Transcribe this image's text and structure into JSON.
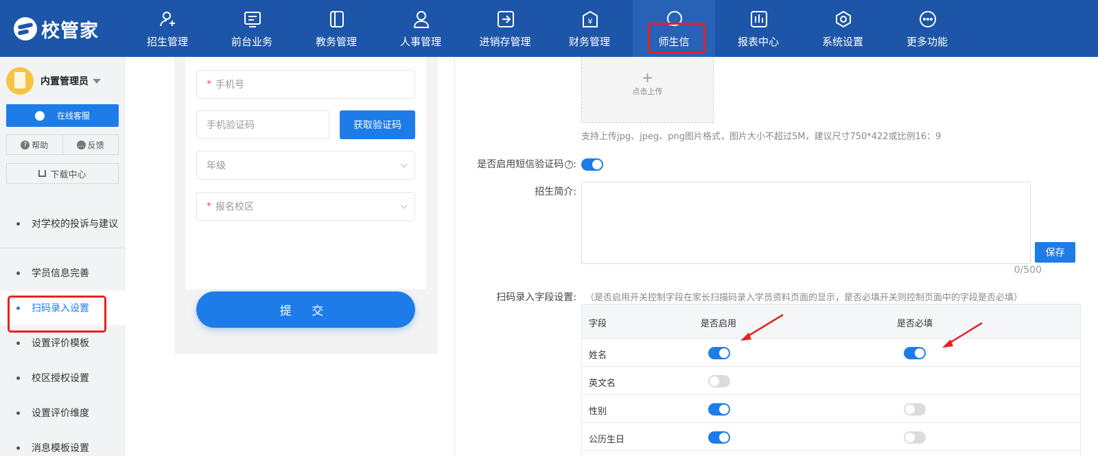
{
  "brand": {
    "name": "校管家"
  },
  "nav": {
    "items": [
      {
        "label": "招生管理",
        "icon": "user-add-icon"
      },
      {
        "label": "前台业务",
        "icon": "monitor-icon"
      },
      {
        "label": "教务管理",
        "icon": "book-icon"
      },
      {
        "label": "人事管理",
        "icon": "person-icon"
      },
      {
        "label": "进销存管理",
        "icon": "inventory-icon"
      },
      {
        "label": "财务管理",
        "icon": "finance-icon"
      },
      {
        "label": "师生信",
        "icon": "chat-icon",
        "active": true
      },
      {
        "label": "报表中心",
        "icon": "chart-icon"
      },
      {
        "label": "系统设置",
        "icon": "settings-icon"
      },
      {
        "label": "更多功能",
        "icon": "more-icon"
      }
    ]
  },
  "sidebar": {
    "user_name": "内置管理员",
    "service_label": "在线客服",
    "help_label": "帮助",
    "feedback_label": "反馈",
    "download_label": "下载中心",
    "items": [
      {
        "label": "对学校的投诉与建议"
      },
      {
        "label": "学员信息完善"
      },
      {
        "label": "扫码录入设置",
        "active": true
      },
      {
        "label": "设置评价模板"
      },
      {
        "label": "校区授权设置"
      },
      {
        "label": "设置评价维度"
      },
      {
        "label": "消息模板设置"
      }
    ]
  },
  "preview_form": {
    "phone_placeholder": "手机号",
    "code_placeholder": "手机验证码",
    "get_code_label": "获取验证码",
    "grade_placeholder": "年级",
    "campus_placeholder": "报名校区",
    "required_mark": "*",
    "submit_label": "提 交"
  },
  "settings": {
    "upload_plus": "+",
    "upload_label": "点击上传",
    "upload_hint": "支持上传jpg、jpeg、png图片格式，图片大小不超过5M，建议尺寸750*422或比例16：9",
    "sms_label": "是否启用短信验证码",
    "sms_help": "?",
    "sms_colon": ":",
    "sms_enabled": true,
    "intro_label": "招生简介:",
    "intro_value": "",
    "save_label": "保存",
    "counter": "0/500",
    "scan_label": "扫码录入字段设置:",
    "scan_desc": "（是否启用开关控制字段在家长扫描码录入学员资料页面的显示，是否必填开关则控制页面中的字段是否必填）",
    "table": {
      "headers": [
        "字段",
        "是否启用",
        "是否必填"
      ],
      "rows": [
        {
          "field": "姓名",
          "enabled": true,
          "required": true
        },
        {
          "field": "英文名",
          "enabled": false,
          "required": null
        },
        {
          "field": "性别",
          "enabled": true,
          "required": false
        },
        {
          "field": "公历生日",
          "enabled": true,
          "required": false
        }
      ]
    }
  },
  "colors": {
    "nav_bg": "#1d56a8",
    "primary": "#1e7ce8",
    "highlight": "#e82020"
  }
}
